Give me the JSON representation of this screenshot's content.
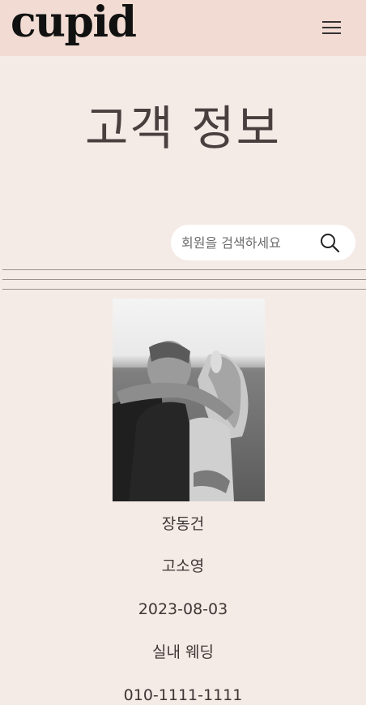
{
  "header": {
    "logo": "cupid",
    "menu_icon": "hamburger-icon"
  },
  "page": {
    "title": "고객 정보"
  },
  "search": {
    "placeholder": "회원을 검색하세요",
    "value": "",
    "icon": "search-icon"
  },
  "customer": {
    "photo_icon": "couple-photo",
    "groom": "장동건",
    "bride": "고소영",
    "date": "2023-08-03",
    "type": "실내 웨딩",
    "phone": "010-1111-1111"
  },
  "colors": {
    "header_bg": "#f1dbd2",
    "page_bg": "#f5ebe6",
    "text": "#3b3333"
  }
}
